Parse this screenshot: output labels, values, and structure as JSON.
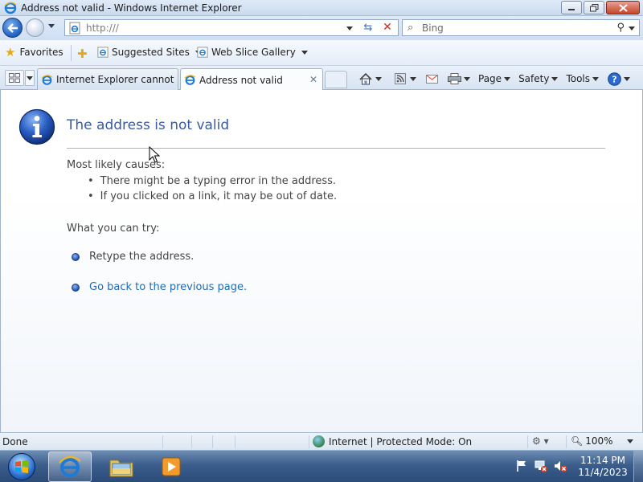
{
  "window": {
    "title": "Address not valid - Windows Internet Explorer",
    "app_icon": "ie-icon",
    "controls": [
      "minimize-icon",
      "restore-icon",
      "close-icon"
    ]
  },
  "nav": {
    "url": "http:///",
    "search_placeholder": "Bing"
  },
  "favorites_bar": {
    "favorites_label": "Favorites",
    "links": [
      {
        "label": "Suggested Sites",
        "has_dropdown": true
      },
      {
        "label": "Web Slice Gallery",
        "has_dropdown": true
      }
    ]
  },
  "tabs": [
    {
      "label": "Internet Explorer cannot di...",
      "active": false
    },
    {
      "label": "Address not valid",
      "active": true
    }
  ],
  "command_bar": {
    "page_label": "Page",
    "safety_label": "Safety",
    "tools_label": "Tools"
  },
  "error_page": {
    "title": "The address is not valid",
    "causes_heading": "Most likely causes:",
    "causes": [
      "There might be a typing error in the address.",
      "If you clicked on a link, it may be out of date."
    ],
    "try_heading": "What you can try:",
    "try_items": [
      {
        "label": "Retype the address.",
        "is_link": false
      },
      {
        "label": "Go back to the previous page.",
        "is_link": true
      }
    ]
  },
  "status_bar": {
    "status": "Done",
    "zone": "Internet | Protected Mode: On",
    "zoom": "100%"
  },
  "taskbar": {
    "time": "11:14 PM",
    "date": "11/4/2023"
  },
  "colors": {
    "title_text": "#3a5aa0",
    "link": "#1f6ab5",
    "taskbar": "#3c5e8c"
  }
}
